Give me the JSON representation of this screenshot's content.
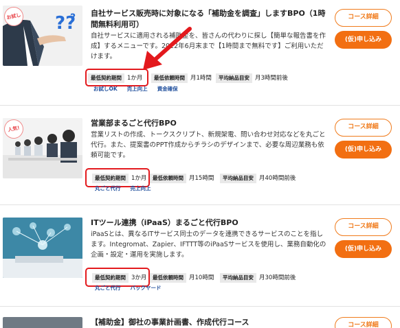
{
  "spec_labels": {
    "min_period": "最低契約期間",
    "min_hours": "最低依頼時間",
    "delivery": "平均納品目安"
  },
  "buttons": {
    "detail": "コース詳細",
    "apply": "(仮)申し込み"
  },
  "items": [
    {
      "badge": "お試し",
      "title": "自社サービス販売時に対象になる「補助金を調査」しますBPO（1時間無料利用可）",
      "description": "自社サービスに適用される補助金を、皆さんの代わりに探し【簡単な報告書を作成】するメニューです。2022年6月末まで【1時間まで無料です】ご利用いただけます。",
      "min_period": "1か月",
      "min_hours": "月1時間",
      "delivery": "月3時間前後",
      "categories": [
        "お試しOK",
        "売上向上",
        "資金確保"
      ]
    },
    {
      "badge": "人気!",
      "title": "営業部まるごと代行BPO",
      "description": "営業リストの作成、トークスクリプト、新規架電、問い合わせ対応などを丸ごと代行。また、提案書のPPT作成からチラシのデザインまで、必要な周辺業務も依頼可能です。",
      "min_period": "1か月",
      "min_hours": "月15時間",
      "delivery": "月40時間前後",
      "categories": [
        "丸ごと代行",
        "売上向上"
      ]
    },
    {
      "title": "ITツール連携（iPaaS）まるごと代行BPO",
      "description": "iPaaSとは、異なるITサービス同士のデータを連携できるサービスのことを指します。Integromat、Zapier、IFTTT等のiPaaSサービスを使用し、業務自動化の企画・設定・運用を実施します。",
      "min_period": "3か月",
      "min_hours": "月10時間",
      "delivery": "月30時間前後",
      "categories": [
        "丸ごと代行",
        "バックヤード"
      ]
    },
    {
      "title": "【補助金】御社の事業計画書、作成代行コース"
    }
  ],
  "colors": {
    "accent": "#f26f12",
    "highlight": "#e3191d",
    "category": "#1f4e9c"
  }
}
